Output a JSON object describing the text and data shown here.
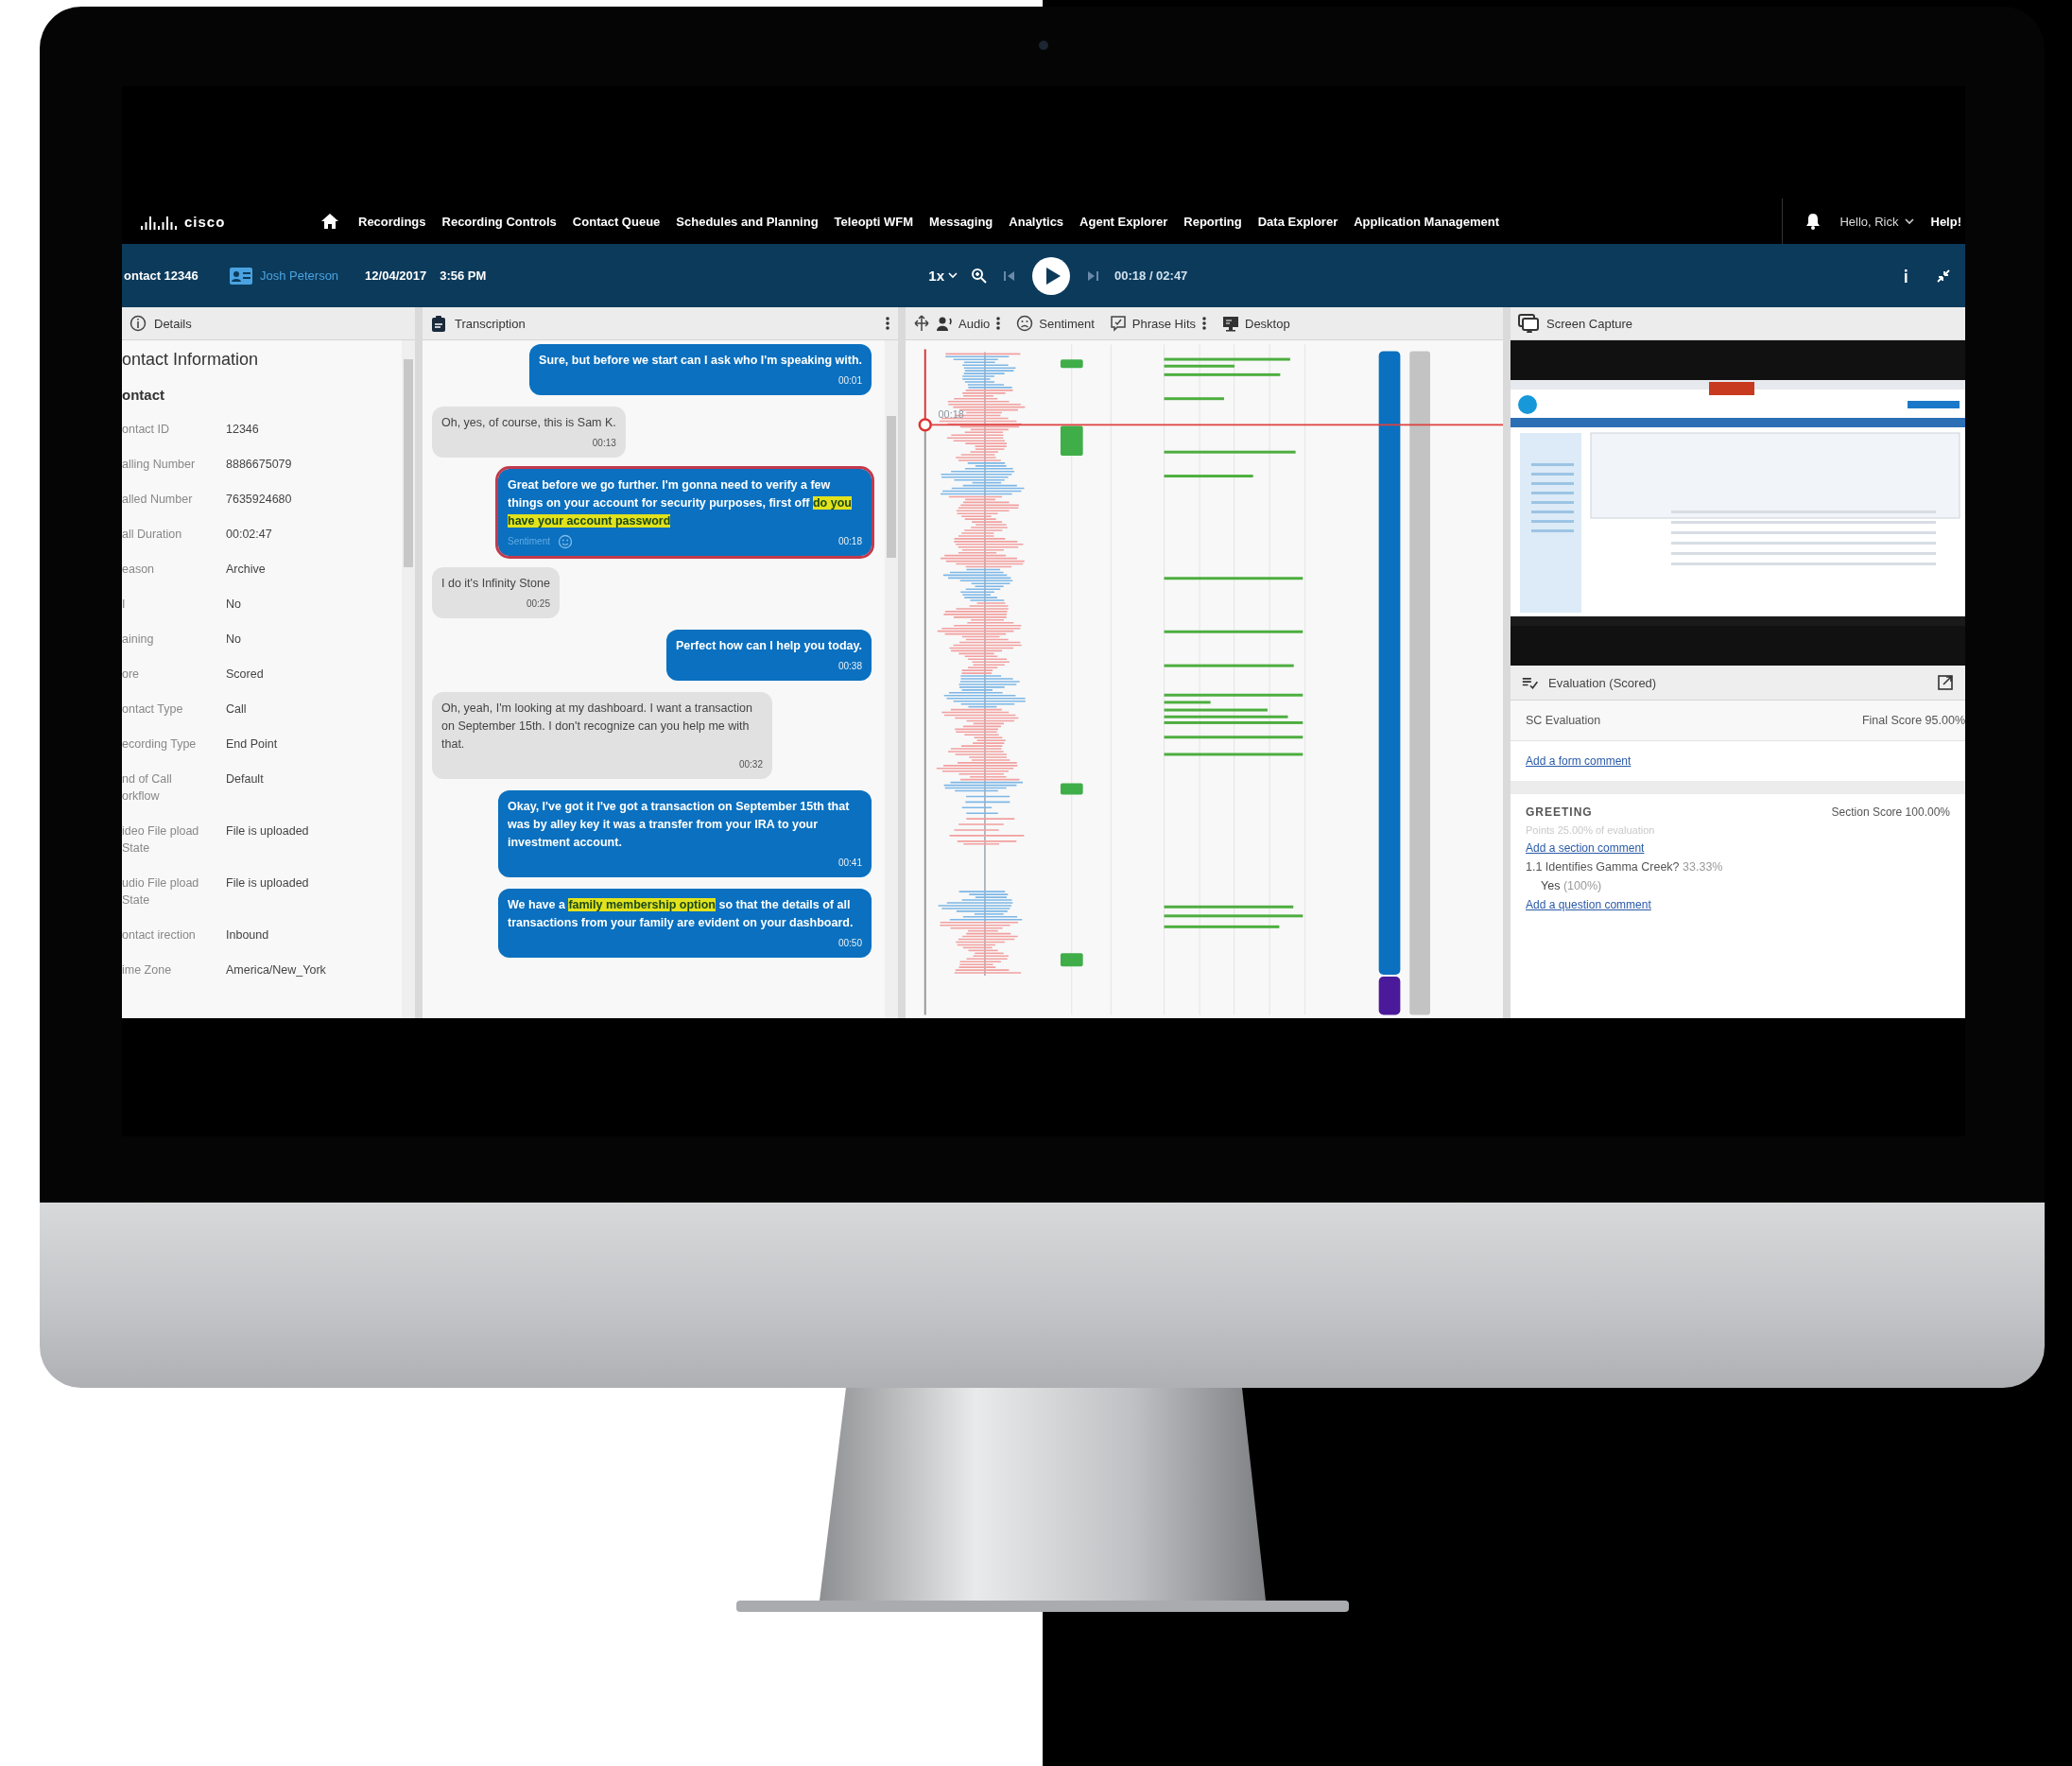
{
  "nav": {
    "logo": "cisco",
    "items": [
      "Recordings",
      "Recording Controls",
      "Contact Queue",
      "Schedules and Planning",
      "Teleopti WFM",
      "Messaging",
      "Analytics",
      "Agent Explorer",
      "Reporting",
      "Data Explorer",
      "Application Management"
    ],
    "greeting": "Hello, Rick",
    "help": "Help!"
  },
  "toolbar": {
    "contact": "ontact 12346",
    "agent": "Josh Peterson",
    "date": "12/04/2017",
    "time": "3:56 PM",
    "speed": "1x",
    "position": "00:18 / 02:47"
  },
  "details": {
    "header": "Details",
    "title": "ontact Information",
    "section": "ontact",
    "fields": [
      {
        "label": "ontact ID",
        "value": "12346"
      },
      {
        "label": "alling Number",
        "value": "8886675079"
      },
      {
        "label": "alled Number",
        "value": "7635924680"
      },
      {
        "label": "all Duration",
        "value": "00:02:47"
      },
      {
        "label": "eason",
        "value": "Archive"
      },
      {
        "label": "I",
        "value": "No"
      },
      {
        "label": "aining",
        "value": "No"
      },
      {
        "label": "ore",
        "value": "Scored"
      },
      {
        "label": "ontact Type",
        "value": "Call"
      },
      {
        "label": "ecording Type",
        "value": "End Point"
      },
      {
        "label": "nd of Call orkflow",
        "value": "Default"
      },
      {
        "label": "ideo File pload State",
        "value": "File is uploaded"
      },
      {
        "label": "udio File pload State",
        "value": "File is uploaded"
      },
      {
        "label": "ontact irection",
        "value": "Inbound"
      },
      {
        "label": "ime Zone",
        "value": "America/New_York"
      }
    ]
  },
  "transcription": {
    "header": "Transcription",
    "messages": [
      {
        "kind": "agent",
        "selected": false,
        "parts": [
          {
            "text": "Sure, but before we start can I ask who I'm speaking with.",
            "highlighted": false
          }
        ],
        "time": "00:01"
      },
      {
        "kind": "customer",
        "selected": false,
        "parts": [
          {
            "text": "Oh, yes, of course, this is Sam K.",
            "highlighted": false
          }
        ],
        "time": "00:13"
      },
      {
        "kind": "agent",
        "selected": true,
        "parts": [
          {
            "text": "Great before we go further. I'm gonna need to verify a few things on your account for security purposes, first off ",
            "highlighted": false
          },
          {
            "text": "do you have your account password",
            "highlighted": true
          }
        ],
        "sentiment": "Sentiment",
        "time": "00:18"
      },
      {
        "kind": "customer",
        "selected": false,
        "parts": [
          {
            "text": "I do it's Infinity Stone",
            "highlighted": false
          }
        ],
        "time": "00:25"
      },
      {
        "kind": "agent",
        "selected": false,
        "parts": [
          {
            "text": "Perfect how can I help you today.",
            "highlighted": false
          }
        ],
        "time": "00:38"
      },
      {
        "kind": "customer",
        "selected": false,
        "parts": [
          {
            "text": "Oh, yeah, I'm looking at my dashboard. I want a transaction on September 15th. I don't recognize can you help me with that.",
            "highlighted": false
          }
        ],
        "time": "00:32"
      },
      {
        "kind": "agent",
        "selected": false,
        "parts": [
          {
            "text": "Okay, I've got it I've got a transaction on September 15th that was by alley key it was a transfer from your IRA to your investment account.",
            "highlighted": false
          }
        ],
        "time": "00:41"
      },
      {
        "kind": "agent",
        "selected": false,
        "parts": [
          {
            "text": "We have a ",
            "highlighted": false
          },
          {
            "text": "family membership option",
            "highlighted": true
          },
          {
            "text": " so that the details of all transactions from your family are evident on your dashboard.",
            "highlighted": false
          }
        ],
        "time": "00:50"
      }
    ]
  },
  "timeline": {
    "columns": [
      {
        "kind": "audio",
        "label": "Audio",
        "menu": true
      },
      {
        "kind": "sentiment",
        "label": "Sentiment",
        "menu": false
      },
      {
        "kind": "phrase_hits",
        "label": "Phrase Hits",
        "menu": true
      },
      {
        "kind": "desktop",
        "label": "Desktop",
        "menu": false
      }
    ],
    "playhead_time": "00:18"
  },
  "screen_capture": {
    "header": "Screen Capture"
  },
  "evaluation": {
    "header": "Evaluation (Scored)",
    "form": "SC Evaluation",
    "final_score": "Final Score 95.00%",
    "form_link": "Add a form comment",
    "section": {
      "title": "GREETING",
      "score": "Section Score 100.00%",
      "weight": "Points 25.00% of evaluation",
      "link": "Add a section comment",
      "questions": [
        {
          "text": "1.1 Identifies Gamma Creek?",
          "weight": "33.33%",
          "answer": "Yes",
          "answer_score": "(100%)",
          "link": "Add a question comment"
        }
      ]
    }
  }
}
